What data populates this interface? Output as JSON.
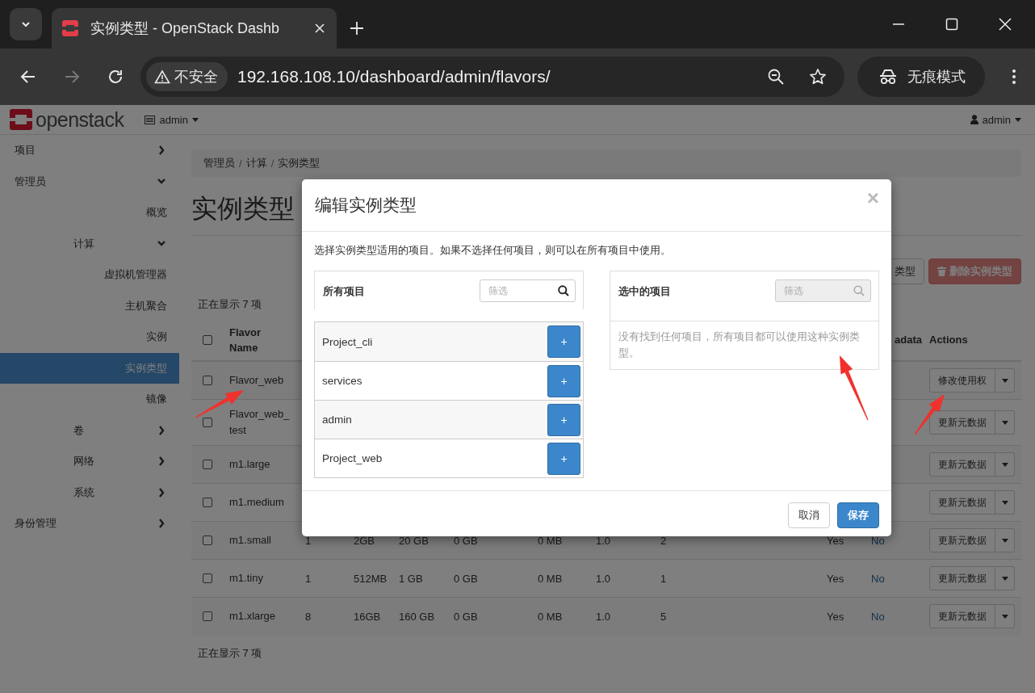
{
  "browser": {
    "tab_title": "实例类型 - OpenStack Dashb",
    "security_label": "不安全",
    "url": "192.168.108.10/dashboard/admin/flavors/",
    "incognito_label": "无痕模式"
  },
  "header": {
    "logo_text": "openstack",
    "project_menu": "admin",
    "user_menu": "admin"
  },
  "sidebar": {
    "items": [
      {
        "kind": "group",
        "label": "项目",
        "expanded": false
      },
      {
        "kind": "group",
        "label": "管理员",
        "expanded": true,
        "children": [
          {
            "kind": "link",
            "label": "概览",
            "selected": false
          },
          {
            "kind": "group",
            "label": "计算",
            "expanded": true,
            "children": [
              {
                "kind": "link",
                "label": "虚拟机管理器",
                "selected": false
              },
              {
                "kind": "link",
                "label": "主机聚合",
                "selected": false
              },
              {
                "kind": "link",
                "label": "实例",
                "selected": false
              },
              {
                "kind": "link",
                "label": "实例类型",
                "selected": true
              },
              {
                "kind": "link",
                "label": "镜像",
                "selected": false
              }
            ]
          },
          {
            "kind": "group",
            "label": "卷",
            "expanded": false
          },
          {
            "kind": "group",
            "label": "网络",
            "expanded": false
          },
          {
            "kind": "group",
            "label": "系统",
            "expanded": false
          }
        ]
      },
      {
        "kind": "group",
        "label": "身份管理",
        "expanded": false
      }
    ]
  },
  "breadcrumb": {
    "separator": "/",
    "items": [
      "管理员",
      "计算",
      "实例类型"
    ]
  },
  "page_title": "实例类型",
  "toolbar": {
    "create_button": "类型",
    "delete_button": "删除实例类型"
  },
  "table": {
    "count_top": "正在显示 7 项",
    "count_bottom": "正在显示 7 项",
    "select_all_checked": false,
    "columns": {
      "name": "Flavor Name",
      "metadata": "adata",
      "actions": "Actions"
    },
    "rows": [
      {
        "checked": false,
        "name": "Flavor_web",
        "action": "修改使用权"
      },
      {
        "checked": false,
        "name": "Flavor_web_ test",
        "action": "更新元数据"
      },
      {
        "checked": false,
        "name": "m1.large",
        "action": "更新元数据"
      },
      {
        "checked": false,
        "name": "m1.medium",
        "action": "更新元数据"
      },
      {
        "checked": false,
        "name": "m1.small",
        "vcpus": "1",
        "ram": "2GB",
        "root_disk": "20 GB",
        "ephemeral": "0 GB",
        "swap": "0 MB",
        "rxtx": "1.0",
        "id": "2",
        "public": "Yes",
        "metadata": "No",
        "action": "更新元数据"
      },
      {
        "checked": false,
        "name": "m1.tiny",
        "vcpus": "1",
        "ram": "512MB",
        "root_disk": "1 GB",
        "ephemeral": "0 GB",
        "swap": "0 MB",
        "rxtx": "1.0",
        "id": "1",
        "public": "Yes",
        "metadata": "No",
        "action": "更新元数据"
      },
      {
        "checked": false,
        "name": "m1.xlarge",
        "vcpus": "8",
        "ram": "16GB",
        "root_disk": "160 GB",
        "ephemeral": "0 GB",
        "swap": "0 MB",
        "rxtx": "1.0",
        "id": "5",
        "public": "Yes",
        "metadata": "No",
        "action": "更新元数据"
      }
    ]
  },
  "modal": {
    "title": "编辑实例类型",
    "close": "×",
    "description": "选择实例类型适用的项目。如果不选择任何项目，则可以在所有项目中使用。",
    "available": {
      "heading": "所有项目",
      "filter_placeholder": "筛选",
      "items": [
        {
          "name": "Project_cli",
          "add": "+"
        },
        {
          "name": "services",
          "add": "+"
        },
        {
          "name": "admin",
          "add": "+"
        },
        {
          "name": "Project_web",
          "add": "+"
        }
      ]
    },
    "selected": {
      "heading": "选中的项目",
      "filter_placeholder": "筛选",
      "filter_disabled": true,
      "empty_message": "没有找到任何项目，所有项目都可以使用这种实例类型。"
    },
    "cancel_button": "取消",
    "save_button": "保存"
  }
}
